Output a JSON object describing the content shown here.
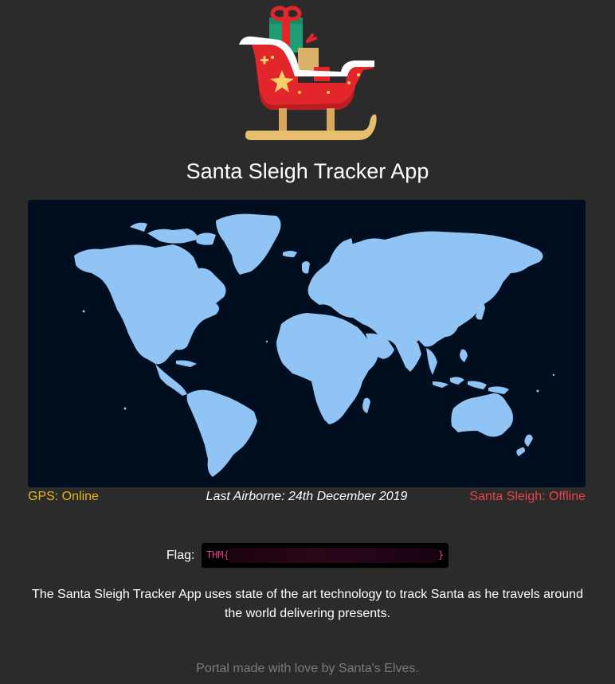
{
  "app": {
    "title": "Santa Sleigh Tracker App"
  },
  "logo": {
    "icon": "sleigh-with-presents-icon"
  },
  "map": {
    "icon": "world-map",
    "land_color": "#90c4f5",
    "ocean_color": "#000e1f"
  },
  "status": {
    "gps": "GPS: Online",
    "gps_color": "#e6b517",
    "last_airborne": "Last Airborne: 24th December 2019",
    "sleigh": "Santa Sleigh: Offline",
    "sleigh_color": "#e8424c"
  },
  "flag": {
    "label": "Flag:",
    "prefix": "THM{",
    "suffix": "}"
  },
  "description": "The Santa Sleigh Tracker App uses state of the art technology to track Santa as he travels around the world delivering presents.",
  "footer": "Portal made with love by Santa's Elves."
}
